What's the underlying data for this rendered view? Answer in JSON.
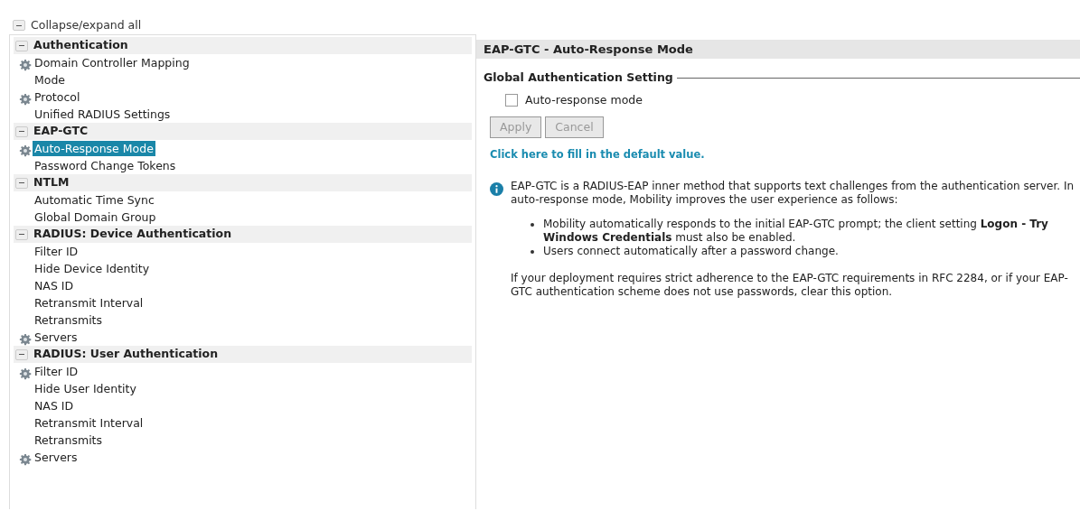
{
  "collapse_all": {
    "label": "Collapse/expand all"
  },
  "tree": [
    {
      "label": "Authentication",
      "expanded": true,
      "items": [
        {
          "label": "Domain Controller Mapping",
          "configured": true,
          "selected": false
        },
        {
          "label": "Mode",
          "configured": false,
          "selected": false
        },
        {
          "label": "Protocol",
          "configured": true,
          "selected": false
        },
        {
          "label": "Unified RADIUS Settings",
          "configured": false,
          "selected": false
        }
      ]
    },
    {
      "label": "EAP-GTC",
      "expanded": true,
      "items": [
        {
          "label": "Auto-Response Mode",
          "configured": true,
          "selected": true
        },
        {
          "label": "Password Change Tokens",
          "configured": false,
          "selected": false
        }
      ]
    },
    {
      "label": "NTLM",
      "expanded": true,
      "items": [
        {
          "label": "Automatic Time Sync",
          "configured": false,
          "selected": false
        },
        {
          "label": "Global Domain Group",
          "configured": false,
          "selected": false
        }
      ]
    },
    {
      "label": "RADIUS: Device Authentication",
      "expanded": true,
      "items": [
        {
          "label": "Filter ID",
          "configured": false,
          "selected": false
        },
        {
          "label": "Hide Device Identity",
          "configured": false,
          "selected": false
        },
        {
          "label": "NAS ID",
          "configured": false,
          "selected": false
        },
        {
          "label": "Retransmit Interval",
          "configured": false,
          "selected": false
        },
        {
          "label": "Retransmits",
          "configured": false,
          "selected": false
        },
        {
          "label": "Servers",
          "configured": true,
          "selected": false
        }
      ]
    },
    {
      "label": "RADIUS: User Authentication",
      "expanded": true,
      "items": [
        {
          "label": "Filter ID",
          "configured": true,
          "selected": false
        },
        {
          "label": "Hide User Identity",
          "configured": false,
          "selected": false
        },
        {
          "label": "NAS ID",
          "configured": false,
          "selected": false
        },
        {
          "label": "Retransmit Interval",
          "configured": false,
          "selected": false
        },
        {
          "label": "Retransmits",
          "configured": false,
          "selected": false
        },
        {
          "label": "Servers",
          "configured": true,
          "selected": false
        }
      ]
    }
  ],
  "panel": {
    "title": "EAP-GTC - Auto-Response Mode",
    "fieldset_legend": "Global Authentication Setting",
    "checkbox": {
      "label": "Auto-response mode",
      "checked": false
    },
    "buttons": [
      {
        "label": "Apply",
        "disabled": true
      },
      {
        "label": "Cancel",
        "disabled": true
      }
    ],
    "default_link": "Click here to fill in the default value.",
    "info": "EAP-GTC is a RADIUS-EAP inner method that supports text challenges from the authentication server. In auto-response mode, Mobility improves the user experience as follows:",
    "bullets": [
      "Mobility automatically responds to the initial EAP-GTC prompt; the client setting **Logon - Try Windows Credentials** must also be enabled.",
      "Users connect automatically after a password change."
    ],
    "note": "If your deployment requires strict adherence to the EAP-GTC requirements in RFC 2284, or if your EAP-GTC authentication scheme does not use passwords, clear this option."
  }
}
